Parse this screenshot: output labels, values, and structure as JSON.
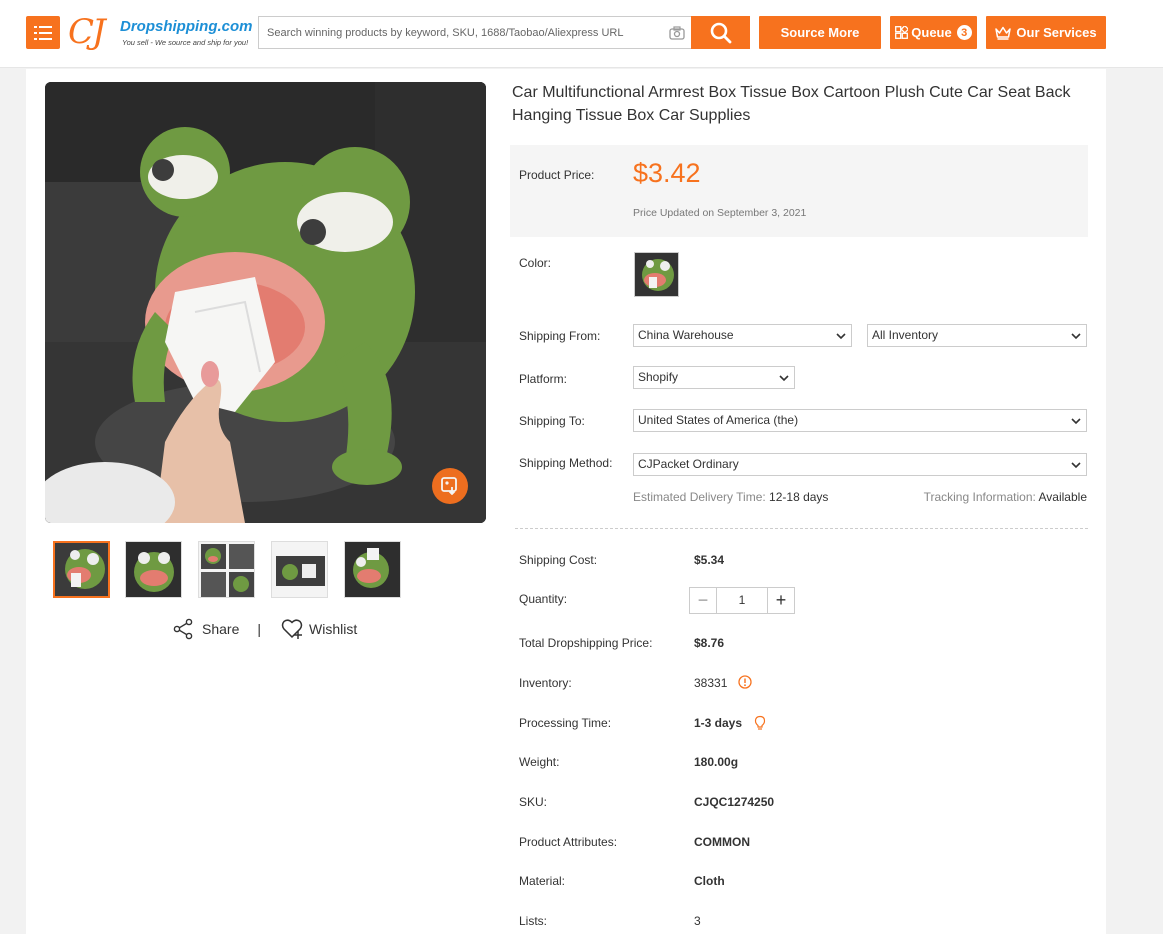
{
  "header": {
    "logo": {
      "brand": "Dropshipping.com",
      "slogan": "You sell - We source and ship for you!"
    },
    "search": {
      "placeholder": "Search winning products by keyword, SKU, 1688/Taobao/Aliexpress URL"
    },
    "buttons": {
      "source_more": "Source More",
      "queue": "Queue",
      "queue_count": "3",
      "our_services": "Our Services"
    },
    "accent_color": "#f7721e"
  },
  "product": {
    "title": "Car Multifunctional Armrest Box Tissue Box Cartoon Plush Cute Car Seat Back Hanging Tissue Box Car Supplies",
    "price_label": "Product Price:",
    "price": "$3.42",
    "price_updated": "Price Updated on September 3, 2021",
    "color_label": "Color:",
    "shipping_from_label": "Shipping From:",
    "shipping_from": "China Warehouse",
    "inventory_filter": "All Inventory",
    "platform_label": "Platform:",
    "platform": "Shopify",
    "shipping_to_label": "Shipping To:",
    "shipping_to": "United States of America (the)",
    "shipping_method_label": "Shipping Method:",
    "shipping_method": "CJPacket Ordinary",
    "delivery_label": "Estimated Delivery Time:",
    "delivery_value": "12-18 days",
    "tracking_label": "Tracking Information:",
    "tracking_value": "Available",
    "details": {
      "shipping_cost_label": "Shipping Cost:",
      "shipping_cost": "$5.34",
      "quantity_label": "Quantity:",
      "quantity": "1",
      "total_label": "Total Dropshipping Price:",
      "total": "$8.76",
      "inventory_label": "Inventory:",
      "inventory": "38331",
      "processing_label": "Processing Time:",
      "processing": "1-3 days",
      "weight_label": "Weight:",
      "weight": "180.00g",
      "sku_label": "SKU:",
      "sku": "CJQC1274250",
      "attributes_label": "Product Attributes:",
      "attributes": "COMMON",
      "material_label": "Material:",
      "material": "Cloth",
      "lists_label": "Lists:",
      "lists": "3"
    }
  },
  "gallery": {
    "thumbnail_count": 5,
    "share_label": "Share",
    "separator": "|",
    "wishlist_label": "Wishlist"
  }
}
